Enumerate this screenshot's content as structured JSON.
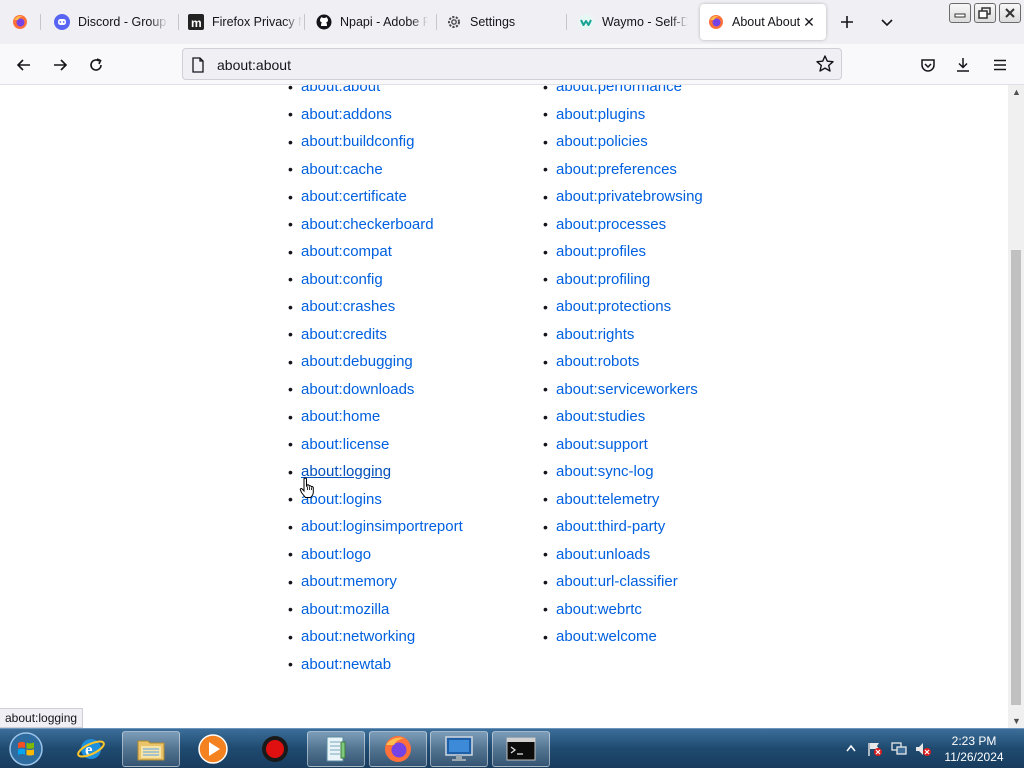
{
  "tabs": [
    {
      "label": "",
      "name": "firefox-view"
    },
    {
      "label": "Discord - Group"
    },
    {
      "label": "Firefox Privacy N"
    },
    {
      "label": "Npapi - Adobe F"
    },
    {
      "label": "Settings"
    },
    {
      "label": "Waymo - Self-Dr"
    },
    {
      "label": "About About",
      "selected": true
    }
  ],
  "navbar": {
    "url": "about:about"
  },
  "about_links": {
    "left": [
      "about:about",
      "about:addons",
      "about:buildconfig",
      "about:cache",
      "about:certificate",
      "about:checkerboard",
      "about:compat",
      "about:config",
      "about:crashes",
      "about:credits",
      "about:debugging",
      "about:downloads",
      "about:home",
      "about:license",
      "about:logging",
      "about:logins",
      "about:loginsimportreport",
      "about:logo",
      "about:memory",
      "about:mozilla",
      "about:networking",
      "about:newtab"
    ],
    "right": [
      "about:performance",
      "about:plugins",
      "about:policies",
      "about:preferences",
      "about:privatebrowsing",
      "about:processes",
      "about:profiles",
      "about:profiling",
      "about:protections",
      "about:rights",
      "about:robots",
      "about:serviceworkers",
      "about:studies",
      "about:support",
      "about:sync-log",
      "about:telemetry",
      "about:third-party",
      "about:unloads",
      "about:url-classifier",
      "about:webrtc",
      "about:welcome"
    ],
    "hovered": "about:logging"
  },
  "status_text": "about:logging",
  "taskbar": {
    "time": "2:23 PM",
    "date": "11/26/2024"
  },
  "colors": {
    "link": "#0060df",
    "tab_strip": "#f0f0f4",
    "taskbar": "#1f4a70"
  }
}
